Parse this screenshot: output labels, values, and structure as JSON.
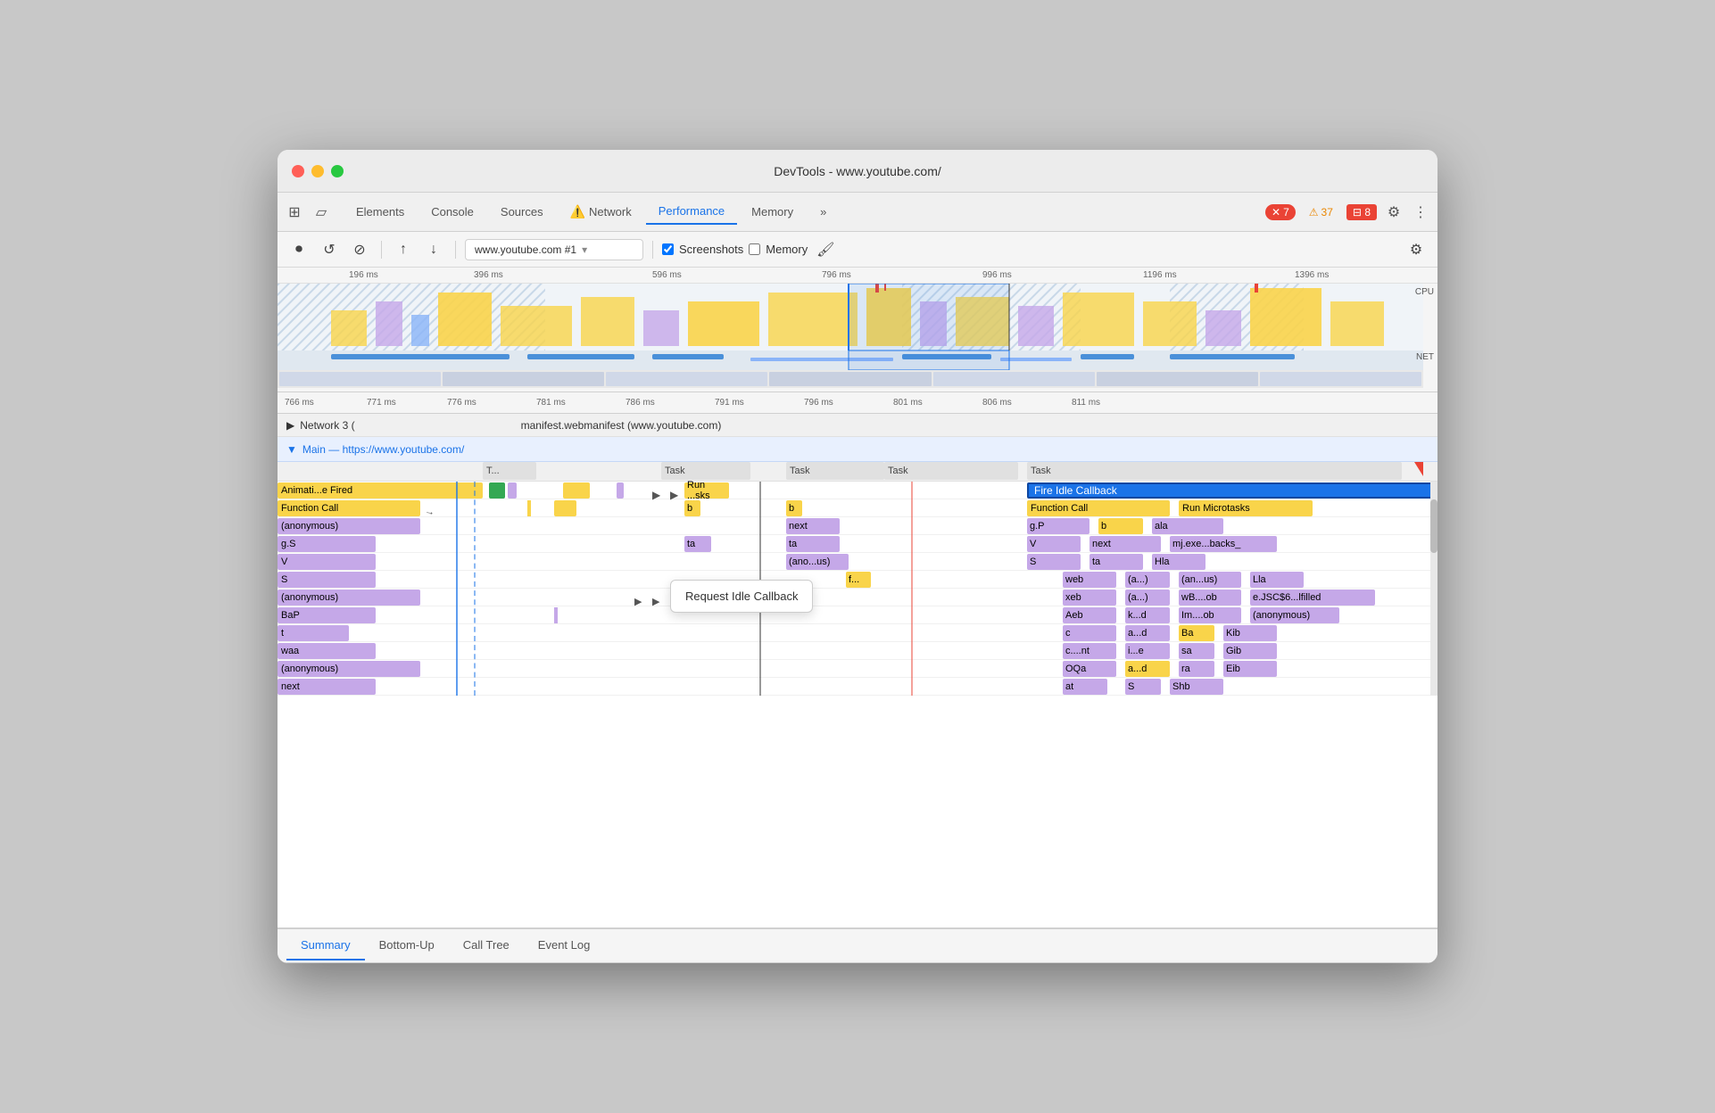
{
  "window": {
    "title": "DevTools - www.youtube.com/"
  },
  "tabs": {
    "items": [
      {
        "label": "Elements",
        "active": false
      },
      {
        "label": "Console",
        "active": false
      },
      {
        "label": "Sources",
        "active": false
      },
      {
        "label": "Network",
        "active": false,
        "icon": "⚠️"
      },
      {
        "label": "Performance",
        "active": true
      },
      {
        "label": "Memory",
        "active": false
      },
      {
        "label": ">>",
        "active": false
      }
    ],
    "errors": "7",
    "warnings": "37",
    "info": "8"
  },
  "toolbar": {
    "url": "www.youtube.com #1",
    "screenshots_label": "Screenshots",
    "memory_label": "Memory",
    "screenshots_checked": true,
    "memory_checked": false
  },
  "timeline": {
    "ruler_marks": [
      "196 ms",
      "396 ms",
      "596 ms",
      "796 ms",
      "996 ms",
      "1196 ms",
      "1396 ms"
    ],
    "detail_marks": [
      "766 ms",
      "771 ms",
      "776 ms",
      "781 ms",
      "786 ms",
      "791 ms",
      "796 ms",
      "801 ms",
      "806 ms",
      "811 ms"
    ],
    "cpu_label": "CPU",
    "net_label": "NET"
  },
  "network_section": {
    "label": "Network 3 (",
    "item": "manifest.webmanifest (www.youtube.com)"
  },
  "main_section": {
    "label": "Main — https://www.youtube.com/"
  },
  "flame": {
    "task_blocks": [
      "T...",
      "Task",
      "Task",
      "Task"
    ],
    "rows": [
      {
        "label": "Animati...e Fired",
        "color": "yellow"
      },
      {
        "label": "Function Call",
        "color": "yellow"
      },
      {
        "label": "(anonymous)",
        "color": "purple"
      },
      {
        "label": "g.S",
        "color": "purple"
      },
      {
        "label": "V",
        "color": "purple"
      },
      {
        "label": "S",
        "color": "purple"
      },
      {
        "label": "(anonymous)",
        "color": "purple"
      },
      {
        "label": "BaP",
        "color": "purple"
      },
      {
        "label": "t",
        "color": "purple"
      },
      {
        "label": "waa",
        "color": "purple"
      },
      {
        "label": "(anonymous)",
        "color": "purple"
      },
      {
        "label": "next",
        "color": "purple"
      }
    ],
    "right_col": [
      {
        "label": "Run ...sks",
        "color": "yellow"
      },
      {
        "label": "b",
        "color": "yellow"
      },
      {
        "label": "next",
        "color": "purple"
      },
      {
        "label": "ta",
        "color": "purple"
      },
      {
        "label": "(ano...us)",
        "color": "purple"
      },
      {
        "label": "f...",
        "color": "yellow"
      }
    ],
    "far_right": [
      {
        "label": "Fire Idle Callback",
        "color": "selected"
      },
      {
        "label": "Function Call",
        "color": "yellow"
      },
      {
        "label": "Run Microtasks",
        "color": "yellow"
      },
      {
        "label": "g.P",
        "color": "purple"
      },
      {
        "label": "b",
        "color": "yellow"
      },
      {
        "label": "ala",
        "color": "purple"
      },
      {
        "label": "V",
        "color": "purple"
      },
      {
        "label": "next",
        "color": "purple"
      },
      {
        "label": "mj.exe...backs_",
        "color": "purple"
      },
      {
        "label": "S",
        "color": "purple"
      },
      {
        "label": "ta",
        "color": "purple"
      },
      {
        "label": "Hla",
        "color": "purple"
      },
      {
        "label": "web",
        "color": "purple"
      },
      {
        "label": "(a...)",
        "color": "purple"
      },
      {
        "label": "(an...us)",
        "color": "purple"
      },
      {
        "label": "Lla",
        "color": "purple"
      },
      {
        "label": "xeb",
        "color": "purple"
      },
      {
        "label": "(a...)",
        "color": "purple"
      },
      {
        "label": "wB....ob",
        "color": "purple"
      },
      {
        "label": "e.JSC$6...lfilled",
        "color": "purple"
      },
      {
        "label": "Aeb",
        "color": "purple"
      },
      {
        "label": "k...d",
        "color": "purple"
      },
      {
        "label": "Im....ob",
        "color": "purple"
      },
      {
        "label": "(anonymous)",
        "color": "purple"
      },
      {
        "label": "c",
        "color": "purple"
      },
      {
        "label": "a...d",
        "color": "purple"
      },
      {
        "label": "Ba",
        "color": "yellow"
      },
      {
        "label": "Kib",
        "color": "purple"
      },
      {
        "label": "c....nt",
        "color": "purple"
      },
      {
        "label": "i...e",
        "color": "purple"
      },
      {
        "label": "sa",
        "color": "purple"
      },
      {
        "label": "Gib",
        "color": "purple"
      },
      {
        "label": "OQa",
        "color": "purple"
      },
      {
        "label": "a...d",
        "color": "yellow"
      },
      {
        "label": "ra",
        "color": "purple"
      },
      {
        "label": "Eib",
        "color": "purple"
      },
      {
        "label": "at",
        "color": "purple"
      },
      {
        "label": "S",
        "color": "purple"
      },
      {
        "label": "Shb",
        "color": "purple"
      }
    ],
    "tooltip": "Request Idle Callback",
    "middle_col": [
      {
        "label": "b",
        "color": "yellow"
      },
      {
        "label": "b",
        "color": "yellow"
      },
      {
        "label": "next",
        "color": "purple"
      },
      {
        "label": "ta",
        "color": "purple"
      }
    ]
  },
  "bottom_tabs": [
    "Summary",
    "Bottom-Up",
    "Call Tree",
    "Event Log"
  ]
}
